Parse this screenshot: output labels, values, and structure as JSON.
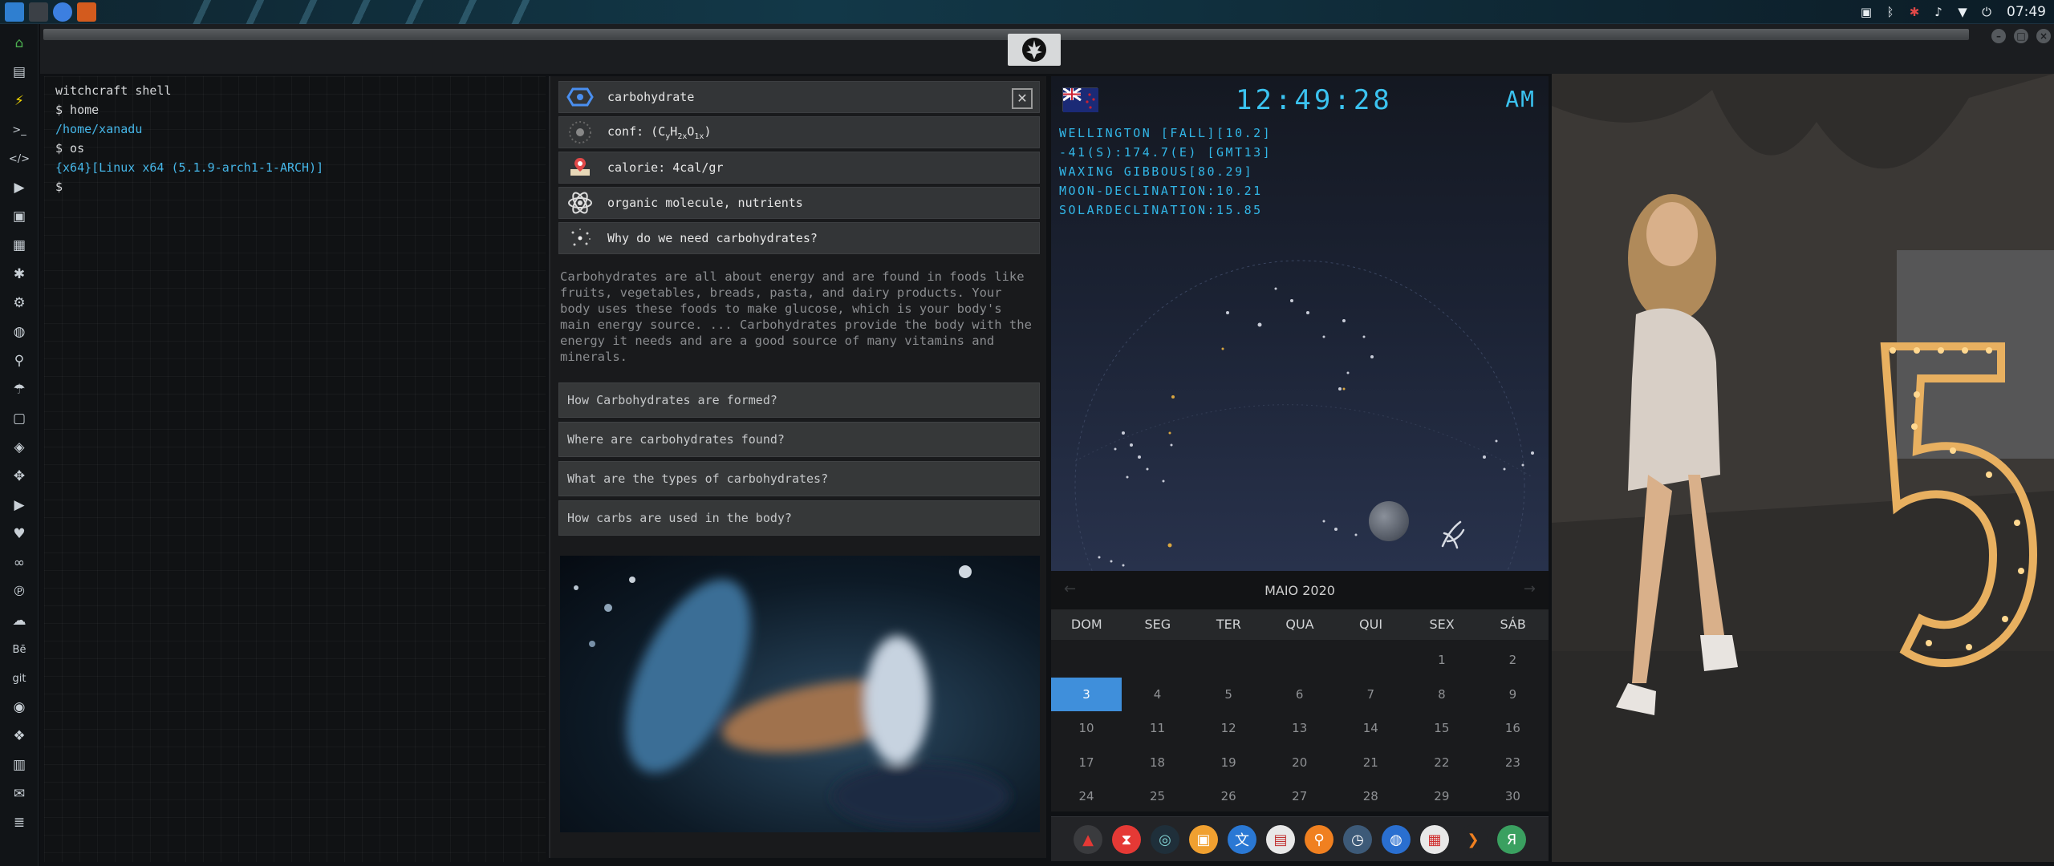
{
  "clock": "07:49",
  "terminal": {
    "lines": [
      {
        "text": "witchcraft shell",
        "color": "default"
      },
      {
        "text": "$ home",
        "color": "default"
      },
      {
        "text": "/home/xanadu",
        "color": "blue"
      },
      {
        "text": "$ os",
        "color": "default"
      },
      {
        "text": "{x64}[Linux x64 (5.1.9-arch1-1-ARCH)]",
        "color": "blue"
      },
      {
        "text": "$",
        "color": "default"
      }
    ]
  },
  "info": {
    "rows": [
      {
        "label": "carbohydrate",
        "icon": "hexagon-molecule-icon"
      },
      {
        "label": "conf: (C",
        "icon": "atom-icon"
      },
      {
        "label": "calorie: 4cal/gr",
        "icon": "map-pin-icon"
      },
      {
        "label": "organic molecule, nutrients",
        "icon": "atom-orbit-icon"
      },
      {
        "label": "Why do we need carbohydrates?",
        "icon": "sparkle-icon"
      }
    ],
    "formula": {
      "c_sub": "y",
      "h": "H",
      "h_sub": "2x",
      "o": "O",
      "o_sub": "1x",
      "close": ")"
    },
    "paragraph": "Carbohydrates are all about energy and are found in foods like fruits, vegetables, breads, pasta, and dairy products. Your body uses these foods to make glucose, which is your body's main energy source. ... Carbohydrates provide the body with the energy it needs and are a good source of many vitamins and minerals.",
    "questions": [
      "How Carbohydrates are formed?",
      "Where are carbohydrates found?",
      "What are the types of carbohydrates?",
      "How carbs are used in the body?"
    ],
    "close_glyph": "✕"
  },
  "astro": {
    "time": "12:49:28",
    "ampm": "AM",
    "lines": [
      "WELLINGTON [FALL][10.2]",
      "-41(S):174.7(E) [GMT13]",
      "WAXING GIBBOUS[80.29]",
      "MOON-DECLINATION:10.21",
      "SOLARDECLINATION:15.85"
    ]
  },
  "calendar": {
    "month": "MAIO 2020",
    "weekdays": [
      "DOM",
      "SEG",
      "TER",
      "QUA",
      "QUI",
      "SEX",
      "SÁB"
    ],
    "weeks": [
      [
        "",
        "",
        "",
        "",
        "",
        "1",
        "2"
      ],
      [
        "3",
        "4",
        "5",
        "6",
        "7",
        "8",
        "9"
      ],
      [
        "10",
        "11",
        "12",
        "13",
        "14",
        "15",
        "16"
      ],
      [
        "17",
        "18",
        "19",
        "20",
        "21",
        "22",
        "23"
      ],
      [
        "24",
        "25",
        "26",
        "27",
        "28",
        "29",
        "30"
      ]
    ],
    "today": "3",
    "prev_arrow": "←",
    "next_arrow": "→"
  },
  "dock_left": [
    {
      "name": "home-icon",
      "glyph": "⌂",
      "color": "#4caf50"
    },
    {
      "name": "document-icon",
      "glyph": "▤",
      "color": "#c9d0d6"
    },
    {
      "name": "lightning-icon",
      "glyph": "⚡",
      "color": "#f5d800"
    },
    {
      "name": "terminal-icon",
      "glyph": ">_",
      "color": "#c9d0d6"
    },
    {
      "name": "code-icon",
      "glyph": "</>",
      "color": "#c9d0d6"
    },
    {
      "name": "play-icon",
      "glyph": "▶",
      "color": "#c9d0d6"
    },
    {
      "name": "image-icon",
      "glyph": "▣",
      "color": "#c9d0d6"
    },
    {
      "name": "news-icon",
      "glyph": "▦",
      "color": "#c9d0d6"
    },
    {
      "name": "aperture-icon",
      "glyph": "✱",
      "color": "#c9d0d6"
    },
    {
      "name": "settings-icon",
      "glyph": "⚙",
      "color": "#c9d0d6"
    },
    {
      "name": "globe-icon",
      "glyph": "◍",
      "color": "#c9d0d6"
    },
    {
      "name": "search-icon",
      "glyph": "⚲",
      "color": "#c9d0d6"
    },
    {
      "name": "umbrella-icon",
      "glyph": "☂",
      "color": "#c9d0d6"
    },
    {
      "name": "contact-icon",
      "glyph": "▢",
      "color": "#c9d0d6"
    },
    {
      "name": "network-icon",
      "glyph": "◈",
      "color": "#c9d0d6"
    },
    {
      "name": "expand-icon",
      "glyph": "✥",
      "color": "#c9d0d6"
    },
    {
      "name": "youtube-icon",
      "glyph": "▶",
      "color": "#c9d0d6"
    },
    {
      "name": "heart-icon",
      "glyph": "♥",
      "color": "#c9d0d6"
    },
    {
      "name": "cloud-link-icon",
      "glyph": "∞",
      "color": "#c9d0d6"
    },
    {
      "name": "pinterest-icon",
      "glyph": "℗",
      "color": "#c9d0d6"
    },
    {
      "name": "cloud-icon",
      "glyph": "☁",
      "color": "#c9d0d6"
    },
    {
      "name": "behance-icon",
      "glyph": "Bē",
      "color": "#c9d0d6"
    },
    {
      "name": "git-icon",
      "glyph": "git",
      "color": "#c9d0d6"
    },
    {
      "name": "github-icon",
      "glyph": "◉",
      "color": "#c9d0d6"
    },
    {
      "name": "cubes-icon",
      "glyph": "❖",
      "color": "#c9d0d6"
    },
    {
      "name": "map-icon",
      "glyph": "▥",
      "color": "#c9d0d6"
    },
    {
      "name": "mail-icon",
      "glyph": "✉",
      "color": "#c9d0d6"
    },
    {
      "name": "server-icon",
      "glyph": "≣",
      "color": "#c9d0d6"
    }
  ],
  "app_dock": [
    {
      "name": "app-red-triangle-icon",
      "glyph": "▲",
      "bg": "#3a3b3e",
      "fg": "#e53935"
    },
    {
      "name": "app-hourglass-icon",
      "glyph": "⧗",
      "bg": "#e53935",
      "fg": "#ffffff"
    },
    {
      "name": "app-globe-dark-icon",
      "glyph": "◎",
      "bg": "#1f2f3a",
      "fg": "#7fd0d0"
    },
    {
      "name": "app-image-viewer-icon",
      "glyph": "▣",
      "bg": "#f0a030",
      "fg": "#ffffff"
    },
    {
      "name": "app-translate-icon",
      "glyph": "文",
      "bg": "#2a78d4",
      "fg": "#ffffff"
    },
    {
      "name": "app-notes-icon",
      "glyph": "▤",
      "bg": "#e8e8e8",
      "fg": "#c03030"
    },
    {
      "name": "app-search-icon",
      "glyph": "⚲",
      "bg": "#f08020",
      "fg": "#ffffff"
    },
    {
      "name": "app-clock-icon",
      "glyph": "◷",
      "bg": "#3d5a78",
      "fg": "#ffffff"
    },
    {
      "name": "app-browser-icon",
      "glyph": "◍",
      "bg": "#2a6fd0",
      "fg": "#ffffff"
    },
    {
      "name": "app-calendar-icon",
      "glyph": "▦",
      "bg": "#e8e8e8",
      "fg": "#d03030"
    },
    {
      "name": "app-arrow-icon",
      "glyph": "❯",
      "bg": "#232427",
      "fg": "#f08020"
    },
    {
      "name": "app-yandex-icon",
      "glyph": "Я",
      "bg": "#3aa060",
      "fg": "#ffffff"
    }
  ],
  "colors": {
    "accent_blue": "#3bc3f0",
    "terminal_blue": "#45b6e8",
    "calendar_today": "#3f8fdb"
  }
}
